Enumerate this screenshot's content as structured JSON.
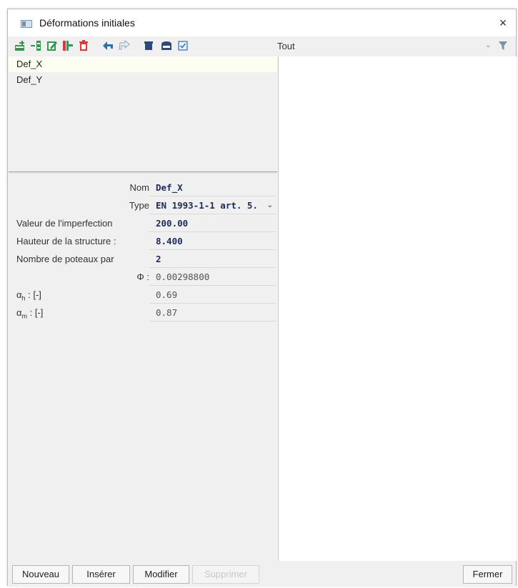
{
  "window": {
    "title": "Déformations initiales",
    "close_glyph": "×"
  },
  "toolbar": {
    "icons": [
      "new-icon",
      "insert-icon",
      "edit-icon",
      "copy-icon",
      "delete-icon",
      "undo-icon",
      "redo-icon",
      "table-icon",
      "save-icon",
      "check-icon"
    ],
    "filter_value": "Tout",
    "filter_chevron": "⌄",
    "funnel_icon": "funnel-icon"
  },
  "list": {
    "items": [
      "Def_X",
      "Def_Y"
    ],
    "selected": "Def_X"
  },
  "properties": {
    "nom": {
      "label": "Nom",
      "value": "Def_X"
    },
    "type": {
      "label": "Type",
      "value": "EN 1993-1-1 art. 5.",
      "chevron": "⌄"
    },
    "valeur": {
      "label": "Valeur de l'imperfection",
      "value": "200.00"
    },
    "hauteur": {
      "label": "Hauteur de la structure :",
      "value": "8.400"
    },
    "nombre": {
      "label": "Nombre de poteaux par",
      "value": "2"
    },
    "phi": {
      "label": "Φ :",
      "value": "0.00298800"
    },
    "alpha_h": {
      "label_prefix": "α",
      "label_sub": "h",
      "label_suffix": " : [-]",
      "value": "0.69"
    },
    "alpha_m": {
      "label_prefix": "α",
      "label_sub": "m",
      "label_suffix": " : [-]",
      "value": "0.87"
    }
  },
  "footer": {
    "nouveau": "Nouveau",
    "inserer": "Insérer",
    "modifier": "Modifier",
    "supprimer": "Supprimer",
    "fermer": "Fermer"
  },
  "colors": {
    "accent_green": "#2e9a4a",
    "accent_red": "#d83b3b",
    "accent_blue": "#2c6fb7",
    "value_text": "#1e2a5a"
  }
}
